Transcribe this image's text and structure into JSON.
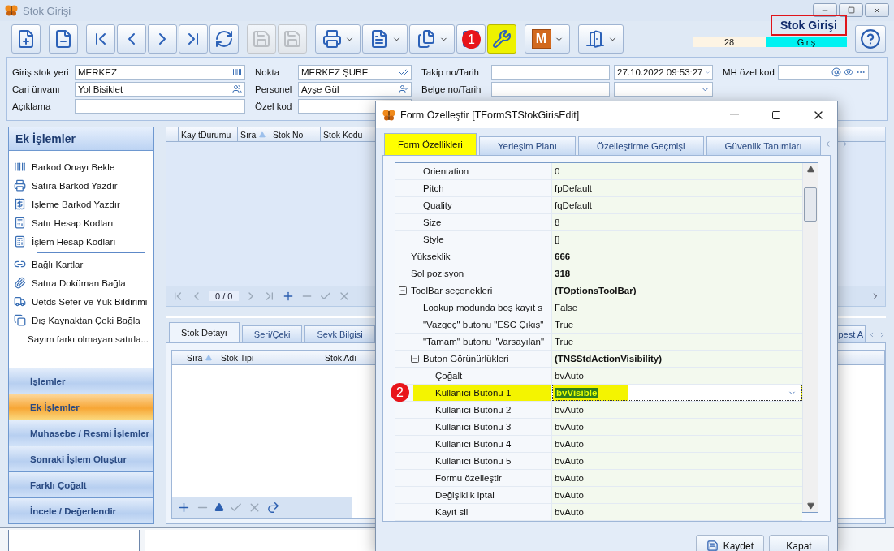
{
  "window": {
    "title": "Stok Girişi"
  },
  "toolbar": {
    "groups": [
      [
        {
          "disabled": false,
          "highlighted": false,
          "split": false
        }
      ],
      [
        {
          "disabled": false,
          "highlighted": false,
          "split": false
        }
      ],
      [
        {
          "disabled": false,
          "highlighted": false,
          "split": false
        },
        {
          "disabled": false,
          "highlighted": false,
          "split": false
        },
        {
          "disabled": false,
          "highlighted": false,
          "split": false
        },
        {
          "disabled": false,
          "highlighted": false,
          "split": false
        },
        {
          "disabled": false,
          "highlighted": false,
          "split": false
        }
      ],
      [
        {
          "disabled": true,
          "highlighted": false,
          "split": false
        },
        {
          "disabled": true,
          "highlighted": false,
          "split": false
        }
      ],
      [
        {
          "disabled": false,
          "highlighted": false,
          "split": true
        },
        {
          "disabled": false,
          "highlighted": false,
          "split": true
        },
        {
          "disabled": false,
          "highlighted": false,
          "split": true
        },
        {
          "disabled": false,
          "highlighted": false,
          "split": false,
          "marker": "1"
        },
        {
          "disabled": false,
          "highlighted": true,
          "split": false
        }
      ],
      [
        {
          "disabled": false,
          "highlighted": false,
          "split": true,
          "glyph": "M"
        }
      ],
      [
        {
          "disabled": false,
          "highlighted": false,
          "split": true
        }
      ]
    ]
  },
  "header": {
    "title": "Stok Girişi",
    "highlighted": true,
    "count": "28",
    "mode": "Giriş"
  },
  "form": {
    "columns": [
      {
        "fields": [
          {
            "label": "Giriş stok yeri",
            "value": "MERKEZ"
          },
          {
            "label": "Cari ünvanı",
            "value": "Yol Bisiklet"
          },
          {
            "label": "Açıklama"
          }
        ]
      },
      {
        "fields": [
          {
            "label": "Nokta",
            "value": "MERKEZ ŞUBE"
          },
          {
            "label": "Personel",
            "value": "Ayşe Gül"
          },
          {
            "label": "Özel kod"
          }
        ]
      },
      {
        "fields": [
          {
            "label": "Takip no/Tarih",
            "date": "27.10.2022 09:53:27"
          },
          {
            "label": "Belge no/Tarih"
          }
        ]
      },
      {
        "fields": [
          {
            "label": "MH özel kod"
          }
        ]
      }
    ]
  },
  "side_panel": {
    "title": "Ek İşlemler",
    "groups": [
      [
        {
          "label": "Barkod Onayı Bekle"
        },
        {
          "label": "Satıra Barkod Yazdır"
        },
        {
          "label": "İşleme Barkod Yazdır"
        },
        {
          "label": "Satır Hesap Kodları"
        },
        {
          "label": "İşlem Hesap Kodları"
        }
      ],
      [
        {
          "label": "Bağlı Kartlar"
        },
        {
          "label": "Satıra Doküman Bağla"
        },
        {
          "label": "Uetds Sefer ve Yük Bildirimi"
        },
        {
          "label": "Dış Kaynaktan Çeki Bağla"
        },
        {
          "label": "Sayım farkı olmayan satırla..."
        }
      ]
    ],
    "sections": [
      {
        "label": "İşlemler",
        "selected": false
      },
      {
        "label": "Ek İşlemler",
        "selected": true
      },
      {
        "label": "Muhasebe / Resmi İşlemler",
        "selected": false
      },
      {
        "label": "Sonraki İşlem Oluştur",
        "selected": false
      },
      {
        "label": "Farklı Çoğalt",
        "selected": false
      },
      {
        "label": "İncele / Değerlendir",
        "selected": false
      }
    ]
  },
  "main_grid": {
    "columns": [
      "KayıtDurumu",
      "Sıra",
      "Stok No",
      "Stok Kodu"
    ],
    "counter": "0 / 0"
  },
  "detail_tabs": [
    {
      "label": "Stok Detayı",
      "selected": true,
      "kind": "tab"
    },
    {
      "label": "Seri/Çeki",
      "selected": false,
      "kind": "tab"
    },
    {
      "label": "Sevk Bilgisi",
      "selected": false,
      "kind": "tab"
    },
    {
      "label": "pest A",
      "selected": false,
      "kind": "partial"
    }
  ],
  "detail_grid": {
    "columns": [
      "Sıra",
      "Stok Tipi",
      "Stok Adı"
    ]
  },
  "dialog": {
    "title": "Form Özelleştir [TFormSTStokGirisEdit]",
    "tabs": [
      {
        "label": "Form Özellikleri",
        "selected": true,
        "highlighted": true
      },
      {
        "label": "Yerleşim Planı",
        "selected": false,
        "highlighted": false
      },
      {
        "label": "Özelleştirme Geçmişi",
        "selected": false,
        "highlighted": false
      },
      {
        "label": "Güvenlik Tanımları",
        "selected": false,
        "highlighted": false
      }
    ],
    "properties": [
      {
        "children": [
          {
            "name": "Orientation",
            "value": "0",
            "modified": false,
            "selected": false
          },
          {
            "name": "Pitch",
            "value": "fpDefault",
            "modified": false,
            "selected": false
          },
          {
            "name": "Quality",
            "value": "fqDefault",
            "modified": false,
            "selected": false
          },
          {
            "name": "Size",
            "value": "8",
            "modified": false,
            "selected": false
          },
          {
            "name": "Style",
            "value": "[]",
            "modified": false,
            "selected": false
          }
        ]
      },
      {
        "name": "Yükseklik",
        "value": "666",
        "modified": true,
        "selected": false
      },
      {
        "name": "Sol pozisyon",
        "value": "318",
        "modified": true,
        "selected": false
      },
      {
        "name": "ToolBar seçenekleri",
        "value": "(TOptionsToolBar)",
        "modified": true,
        "selected": false,
        "expanded": true,
        "children": [
          {
            "name": "Lookup modunda boş kayıt s",
            "value": "False",
            "modified": false,
            "selected": false
          },
          {
            "name": "\"Vazgeç\" butonu \"ESC Çıkış\"",
            "value": "True",
            "modified": false,
            "selected": false
          },
          {
            "name": "\"Tamam\" butonu \"Varsayılan\"",
            "value": "True",
            "modified": false,
            "selected": false
          },
          {
            "name": "Buton Görünürlükleri",
            "value": "(TNSStdActionVisibility)",
            "modified": true,
            "selected": false,
            "expanded": true,
            "children": [
              {
                "name": "Çoğalt",
                "value": "bvAuto",
                "modified": false,
                "selected": false
              },
              {
                "name": "Kullanıcı Butonu 1",
                "value": "bvVisible",
                "modified": true,
                "selected": true,
                "highlighted": true,
                "marker": "2"
              },
              {
                "name": "Kullanıcı Butonu 2",
                "value": "bvAuto",
                "modified": false,
                "selected": false
              },
              {
                "name": "Kullanıcı Butonu 3",
                "value": "bvAuto",
                "modified": false,
                "selected": false
              },
              {
                "name": "Kullanıcı Butonu 4",
                "value": "bvAuto",
                "modified": false,
                "selected": false
              },
              {
                "name": "Kullanıcı Butonu 5",
                "value": "bvAuto",
                "modified": false,
                "selected": false
              },
              {
                "name": "Formu özelleştir",
                "value": "bvAuto",
                "modified": false,
                "selected": false
              },
              {
                "name": "Değişiklik iptal",
                "value": "bvAuto",
                "modified": false,
                "selected": false
              },
              {
                "name": "Kayıt sil",
                "value": "bvAuto",
                "modified": false,
                "selected": false
              }
            ]
          }
        ]
      }
    ],
    "buttons": [
      {
        "label": "Kaydet",
        "kind": "save"
      },
      {
        "label": "Kapat",
        "kind": "plain"
      }
    ]
  }
}
